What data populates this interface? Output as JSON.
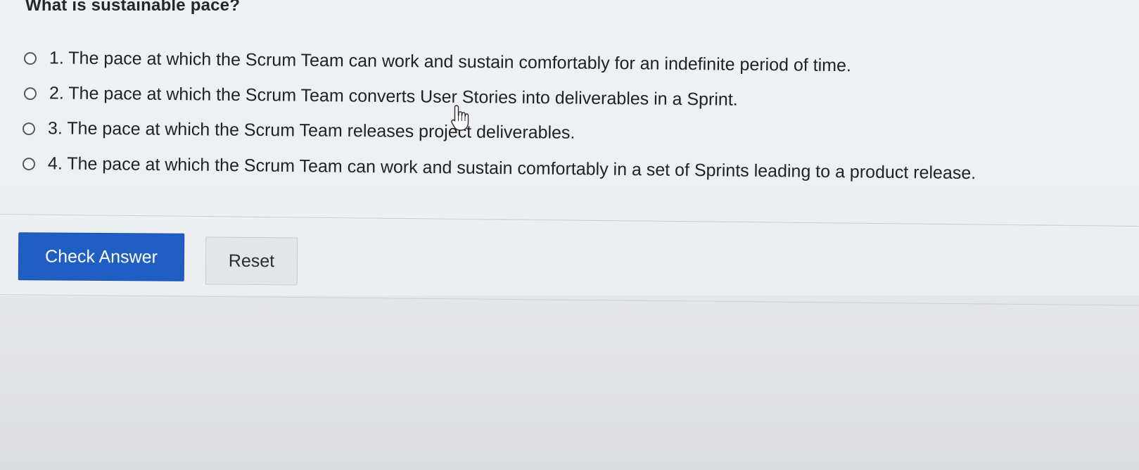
{
  "question": {
    "title": "What is sustainable pace?"
  },
  "options": [
    {
      "label": "1. The pace at which the Scrum Team can work and sustain comfortably for an indefinite period of time."
    },
    {
      "label": "2. The pace at which the Scrum Team converts User Stories into deliverables in a Sprint."
    },
    {
      "label": "3. The pace at which the Scrum Team releases project deliverables."
    },
    {
      "label": "4. The pace at which the Scrum Team can work and sustain comfortably in a set of Sprints leading to a product release."
    }
  ],
  "actions": {
    "check_label": "Check Answer",
    "reset_label": "Reset"
  },
  "colors": {
    "primary_button": "#1f5fc3",
    "secondary_button": "#e4e5e8",
    "background": "#eceef1"
  },
  "icons": {
    "cursor": "hand-pointer-icon",
    "radio": "radio-unselected-icon"
  }
}
